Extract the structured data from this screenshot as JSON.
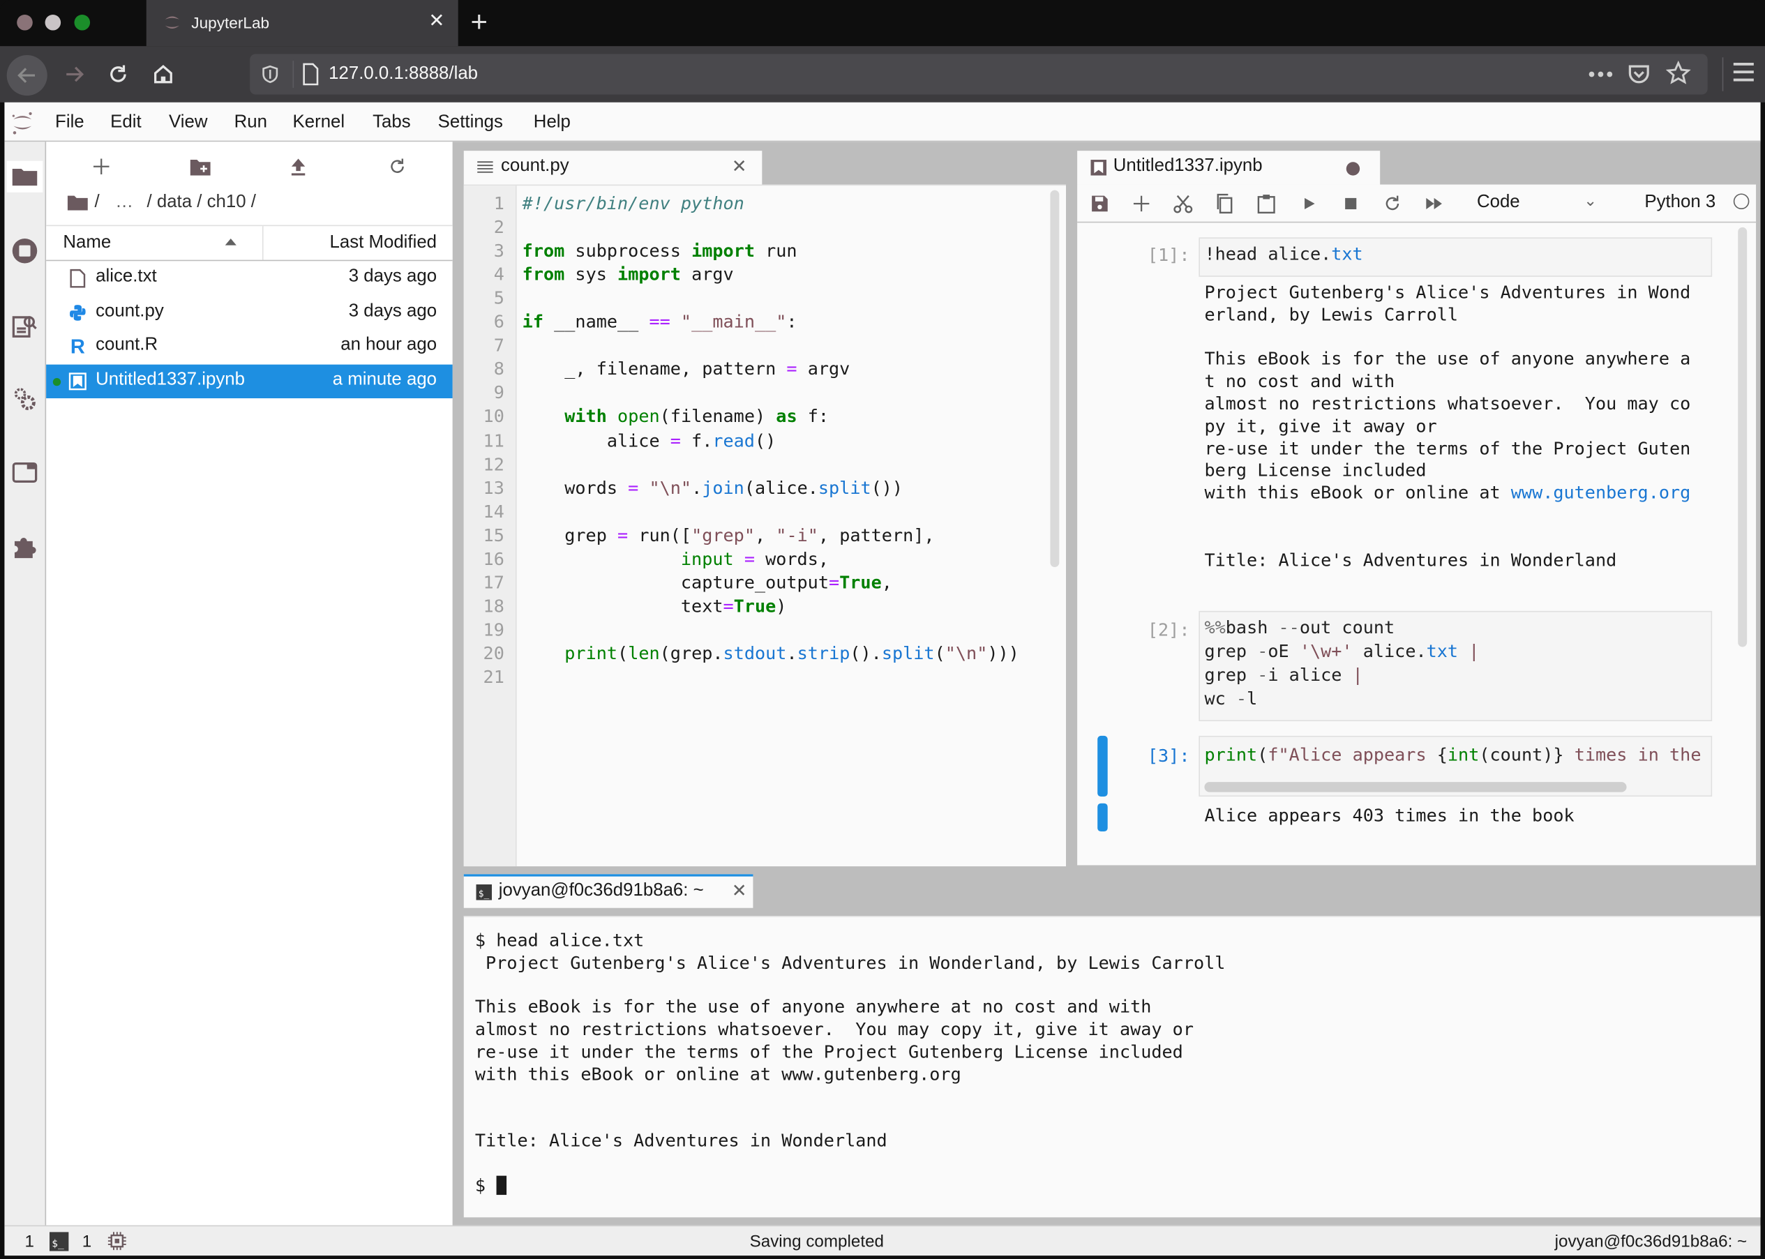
{
  "browser": {
    "tab_title": "JupyterLab",
    "url": "127.0.0.1:8888/lab",
    "traffic_colors": [
      "#8a7378",
      "#c9c4c6",
      "#1b8e2a"
    ]
  },
  "menubar": {
    "items": [
      "File",
      "Edit",
      "View",
      "Run",
      "Kernel",
      "Tabs",
      "Settings",
      "Help"
    ]
  },
  "filebrowser": {
    "breadcrumb": [
      "/",
      "…",
      "/ data / ch10 /"
    ],
    "columns": {
      "name": "Name",
      "modified": "Last Modified"
    },
    "files": [
      {
        "name": "alice.txt",
        "modified": "3 days ago",
        "icon": "file-icon",
        "selected": false,
        "running": false
      },
      {
        "name": "count.py",
        "modified": "3 days ago",
        "icon": "python-icon",
        "selected": false,
        "running": false
      },
      {
        "name": "count.R",
        "modified": "an hour ago",
        "icon": "r-icon",
        "selected": false,
        "running": false
      },
      {
        "name": "Untitled1337.ipynb",
        "modified": "a minute ago",
        "icon": "notebook-icon",
        "selected": true,
        "running": true
      }
    ]
  },
  "editor": {
    "tab_title": "count.py",
    "line_count": 21,
    "lines": [
      "#!/usr/bin/env python",
      "",
      "from subprocess import run",
      "from sys import argv",
      "",
      "if __name__ == \"__main__\":",
      "",
      "    _, filename, pattern = argv",
      "",
      "    with open(filename) as f:",
      "        alice = f.read()",
      "",
      "    words = \"\\n\".join(alice.split())",
      "",
      "    grep = run([\"grep\", \"-i\", pattern],",
      "               input = words,",
      "               capture_output=True,",
      "               text=True)",
      "",
      "    print(len(grep.stdout.strip().split(\"\\n\")))",
      ""
    ]
  },
  "notebook": {
    "tab_title": "Untitled1337.ipynb",
    "dirty": true,
    "cell_type": "Code",
    "kernel_name": "Python 3",
    "kernel_status": "idle",
    "cells": [
      {
        "prompt": "[1]:",
        "source": "!head alice.txt",
        "output": [
          "Project Gutenberg's Alice's Adventures in Wond",
          "erland, by Lewis Carroll",
          "",
          "This eBook is for the use of anyone anywhere a",
          "t no cost and with",
          "almost no restrictions whatsoever.  You may co",
          "py it, give it away or",
          "re-use it under the terms of the Project Guten",
          "berg License included",
          "with this eBook or online at www.gutenberg.org",
          "",
          "",
          "Title: Alice's Adventures in Wonderland"
        ]
      },
      {
        "prompt": "[2]:",
        "source": "%%bash --out count\ngrep -oE '\\w+' alice.txt |\ngrep -i alice |\nwc -l",
        "output": []
      },
      {
        "prompt": "[3]:",
        "source": "print(f\"Alice appears {int(count)} times in the",
        "output": [
          "Alice appears 403 times in the book"
        ],
        "active": true
      }
    ]
  },
  "terminal": {
    "tab_title": "jovyan@f0c36d91b8a6: ~",
    "lines": [
      "$ head alice.txt",
      " Project Gutenberg's Alice's Adventures in Wonderland, by Lewis Carroll",
      "",
      "This eBook is for the use of anyone anywhere at no cost and with",
      "almost no restrictions whatsoever.  You may copy it, give it away or",
      "re-use it under the terms of the Project Gutenberg License included",
      "with this eBook or online at www.gutenberg.org",
      "",
      "",
      "Title: Alice's Adventures in Wonderland",
      ""
    ],
    "prompt": "$ "
  },
  "statusbar": {
    "kernels_count": "1",
    "terminals_count": "1",
    "message": "Saving completed",
    "right_label": "jovyan@f0c36d91b8a6: ~"
  },
  "colors": {
    "accent": "#1e8fe1",
    "keyword": "#008000",
    "string": "#7f4f58",
    "property": "#1976d2"
  }
}
